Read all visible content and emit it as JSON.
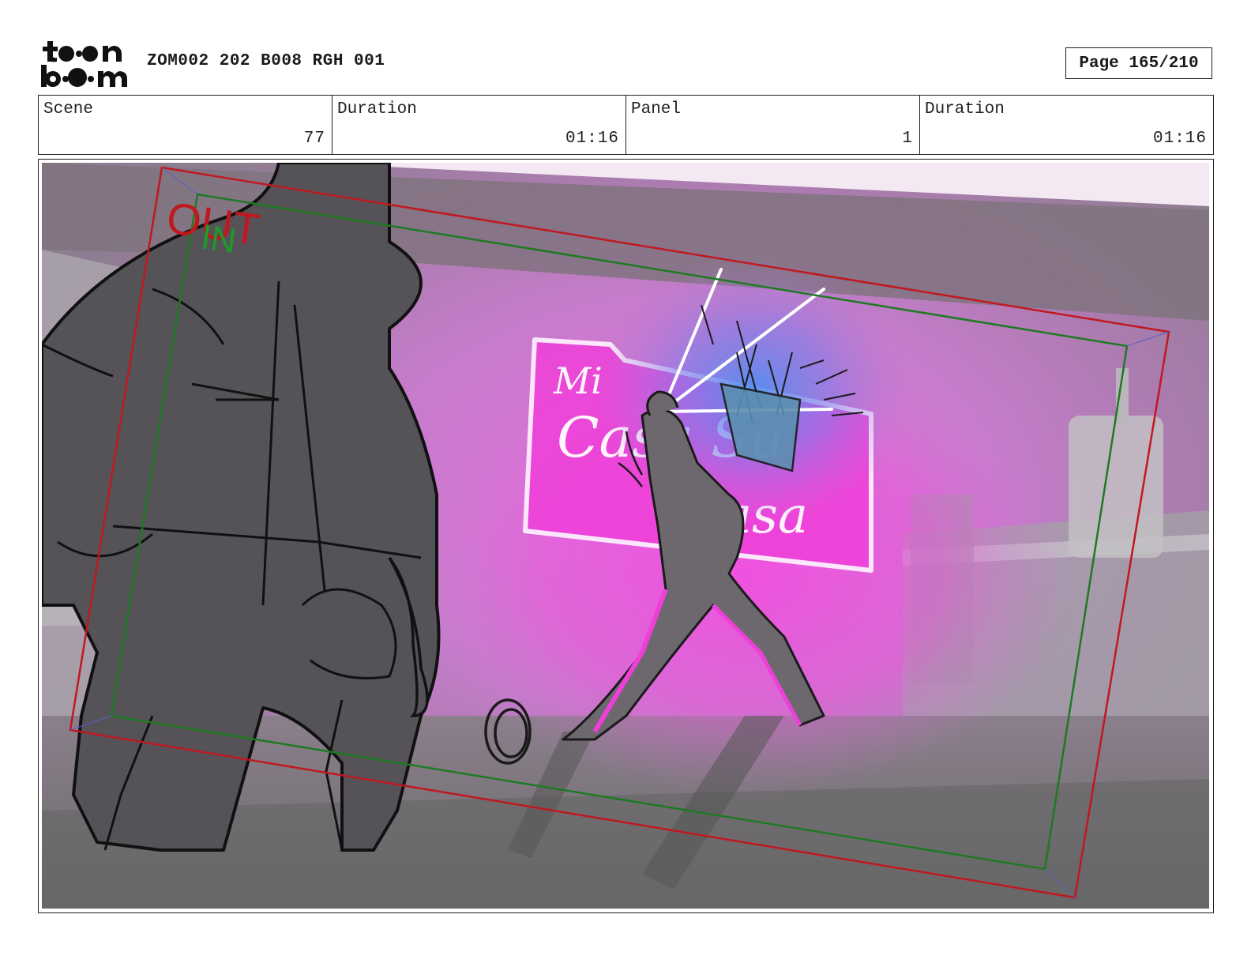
{
  "header": {
    "logo_text": "toon boom",
    "doc_id": "ZOM002 202 B008 RGH 001",
    "page": "Page 165/210"
  },
  "info": {
    "scene_label": "Scene",
    "scene_value": "77",
    "scene_duration_label": "Duration",
    "scene_duration_value": "01:16",
    "panel_label": "Panel",
    "panel_value": "1",
    "panel_duration_label": "Duration",
    "panel_duration_value": "01:16"
  },
  "panel_art": {
    "out_label": "OUT",
    "in_label": "IN",
    "sign_line1": "Mi",
    "sign_line2": "Casa Su",
    "sign_line3": "Casa",
    "colors": {
      "out_frame": "#c0181f",
      "in_frame": "#1e7a22",
      "neon": "#ee3fd8",
      "glow_blue": "#4f8ff0"
    }
  }
}
